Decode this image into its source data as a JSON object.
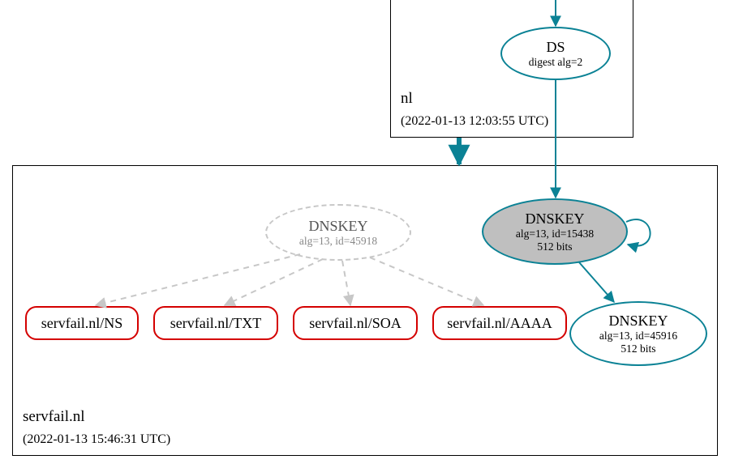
{
  "zones": {
    "nl": {
      "name": "nl",
      "timestamp": "(2022-01-13 12:03:55 UTC)"
    },
    "servfail": {
      "name": "servfail.nl",
      "timestamp": "(2022-01-13 15:46:31 UTC)"
    }
  },
  "nodes": {
    "ds": {
      "title": "DS",
      "sub": "digest alg=2"
    },
    "dnskey_dashed": {
      "title": "DNSKEY",
      "sub": "alg=13, id=45918"
    },
    "dnskey_ksk": {
      "title": "DNSKEY",
      "sub1": "alg=13, id=15438",
      "sub2": "512 bits"
    },
    "dnskey_zsk": {
      "title": "DNSKEY",
      "sub1": "alg=13, id=45916",
      "sub2": "512 bits"
    },
    "rr_ns": {
      "label": "servfail.nl/NS"
    },
    "rr_txt": {
      "label": "servfail.nl/TXT"
    },
    "rr_soa": {
      "label": "servfail.nl/SOA"
    },
    "rr_aaaa": {
      "label": "servfail.nl/AAAA"
    }
  },
  "chart_data": {
    "type": "graph",
    "description": "DNSSEC delegation / validation graph",
    "zones": [
      {
        "id": "nl",
        "label": "nl",
        "timestamp": "2022-01-13 12:03:55 UTC"
      },
      {
        "id": "servfail.nl",
        "label": "servfail.nl",
        "timestamp": "2022-01-13 15:46:31 UTC"
      }
    ],
    "nodes": [
      {
        "id": "ds",
        "zone": "nl",
        "kind": "DS",
        "attrs": {
          "digest_alg": 2
        },
        "status": "secure"
      },
      {
        "id": "ksk",
        "zone": "servfail.nl",
        "kind": "DNSKEY",
        "attrs": {
          "alg": 13,
          "id": 15438,
          "bits": 512
        },
        "status": "secure",
        "role": "KSK",
        "self_signed": true
      },
      {
        "id": "zsk",
        "zone": "servfail.nl",
        "kind": "DNSKEY",
        "attrs": {
          "alg": 13,
          "id": 45916,
          "bits": 512
        },
        "status": "secure"
      },
      {
        "id": "missing_key",
        "zone": "servfail.nl",
        "kind": "DNSKEY",
        "attrs": {
          "alg": 13,
          "id": 45918
        },
        "status": "bogus/missing"
      },
      {
        "id": "rr_ns",
        "zone": "servfail.nl",
        "kind": "RRset",
        "name": "servfail.nl/NS",
        "status": "bogus"
      },
      {
        "id": "rr_txt",
        "zone": "servfail.nl",
        "kind": "RRset",
        "name": "servfail.nl/TXT",
        "status": "bogus"
      },
      {
        "id": "rr_soa",
        "zone": "servfail.nl",
        "kind": "RRset",
        "name": "servfail.nl/SOA",
        "status": "bogus"
      },
      {
        "id": "rr_aaaa",
        "zone": "servfail.nl",
        "kind": "RRset",
        "name": "servfail.nl/AAAA",
        "status": "bogus"
      }
    ],
    "edges": [
      {
        "from": "(parent)",
        "to": "ds",
        "style": "solid-teal"
      },
      {
        "from": "ds",
        "to": "ksk",
        "style": "solid-teal"
      },
      {
        "from": "ksk",
        "to": "ksk",
        "style": "solid-teal",
        "note": "self-loop"
      },
      {
        "from": "ksk",
        "to": "zsk",
        "style": "solid-teal"
      },
      {
        "from": "nl-zone",
        "to": "servfail.nl-zone",
        "style": "solid-teal-thick",
        "note": "delegation"
      },
      {
        "from": "missing_key",
        "to": "rr_ns",
        "style": "dashed-gray"
      },
      {
        "from": "missing_key",
        "to": "rr_txt",
        "style": "dashed-gray"
      },
      {
        "from": "missing_key",
        "to": "rr_soa",
        "style": "dashed-gray"
      },
      {
        "from": "missing_key",
        "to": "rr_aaaa",
        "style": "dashed-gray"
      }
    ]
  }
}
